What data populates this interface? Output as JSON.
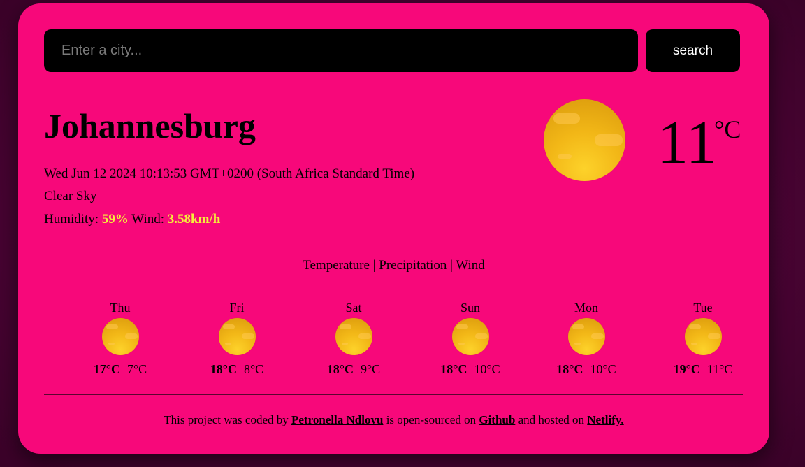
{
  "search": {
    "placeholder": "Enter a city...",
    "value": "",
    "button_label": "search"
  },
  "current": {
    "city": "Johannesburg",
    "date": "Wed Jun 12 2024 10:13:53 GMT+0200 (South Africa Standard Time)",
    "description": "Clear Sky",
    "humidity_label": "Humidity: ",
    "humidity_value": "59%",
    "wind_label": " Wind: ",
    "wind_value": "3.58km/h",
    "temperature": "11",
    "unit": "°C",
    "icon": "sun-icon"
  },
  "tabs": [
    "Temperature",
    "Precipitation",
    "Wind"
  ],
  "tab_separator": " | ",
  "forecast": [
    {
      "day": "Thu",
      "max": "17°C",
      "min": "7°C",
      "icon": "sun-icon"
    },
    {
      "day": "Fri",
      "max": "18°C",
      "min": "8°C",
      "icon": "sun-icon"
    },
    {
      "day": "Sat",
      "max": "18°C",
      "min": "9°C",
      "icon": "sun-icon"
    },
    {
      "day": "Sun",
      "max": "18°C",
      "min": "10°C",
      "icon": "sun-icon"
    },
    {
      "day": "Mon",
      "max": "18°C",
      "min": "10°C",
      "icon": "sun-icon"
    },
    {
      "day": "Tue",
      "max": "19°C",
      "min": "11°C",
      "icon": "sun-icon"
    }
  ],
  "footer": {
    "text1": "This project was coded by ",
    "author": "Petronella Ndlovu",
    "text2": " is open-sourced on ",
    "github": "Github",
    "text3": " and hosted on ",
    "netlify": "Netlify."
  },
  "colors": {
    "card": "#f7087a",
    "highlight": "#f5f03a",
    "background": "#4a0434",
    "input": "#000000"
  }
}
